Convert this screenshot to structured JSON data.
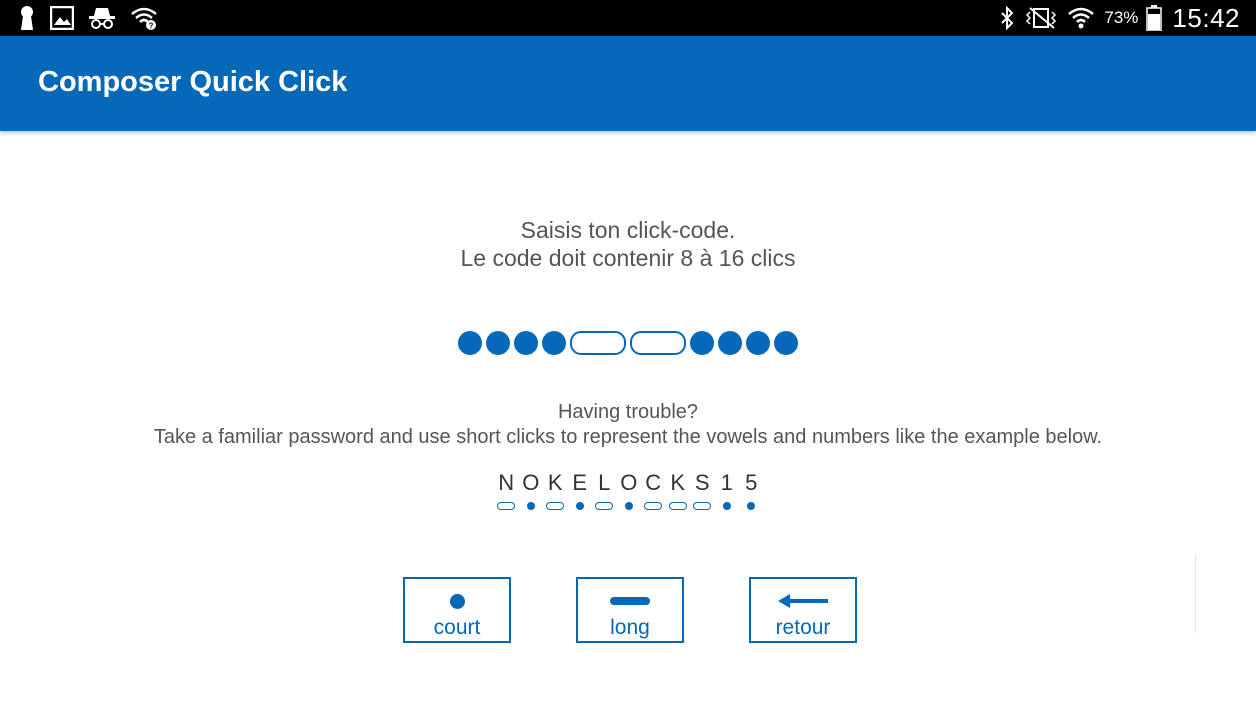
{
  "status_bar": {
    "icons_left": [
      "keyhole-icon",
      "gallery-icon",
      "incognito-icon",
      "wifi-question-icon"
    ],
    "icons_right": [
      "bluetooth-icon",
      "vibrate-icon",
      "wifi-icon",
      "battery-icon"
    ],
    "battery": "73%",
    "time": "15:42"
  },
  "app_bar": {
    "title": "Composer Quick Click"
  },
  "prompt": {
    "line1": "Saisis ton click-code.",
    "line2": "Le code doit contenir 8 à 16 clics"
  },
  "code_sequence": [
    "short",
    "short",
    "short",
    "short",
    "long",
    "long",
    "short",
    "short",
    "short",
    "short"
  ],
  "help": {
    "line1": "Having trouble?",
    "line2": "Take a familiar password and use short clicks to represent the vowels and numbers like the example below."
  },
  "example": {
    "letters": [
      "N",
      "O",
      "K",
      "E",
      "L",
      "O",
      "C",
      "K",
      "S",
      "1",
      "5"
    ],
    "marks": [
      "long",
      "short",
      "long",
      "short",
      "long",
      "short",
      "long",
      "long",
      "long",
      "short",
      "short"
    ]
  },
  "buttons": {
    "short": {
      "label": "court",
      "icon": "dot-icon"
    },
    "long": {
      "label": "long",
      "icon": "dash-icon"
    },
    "back": {
      "label": "retour",
      "icon": "arrow-left-icon"
    }
  },
  "colors": {
    "accent": "#0568b8",
    "text": "#555555",
    "status_bar": "#000000"
  }
}
